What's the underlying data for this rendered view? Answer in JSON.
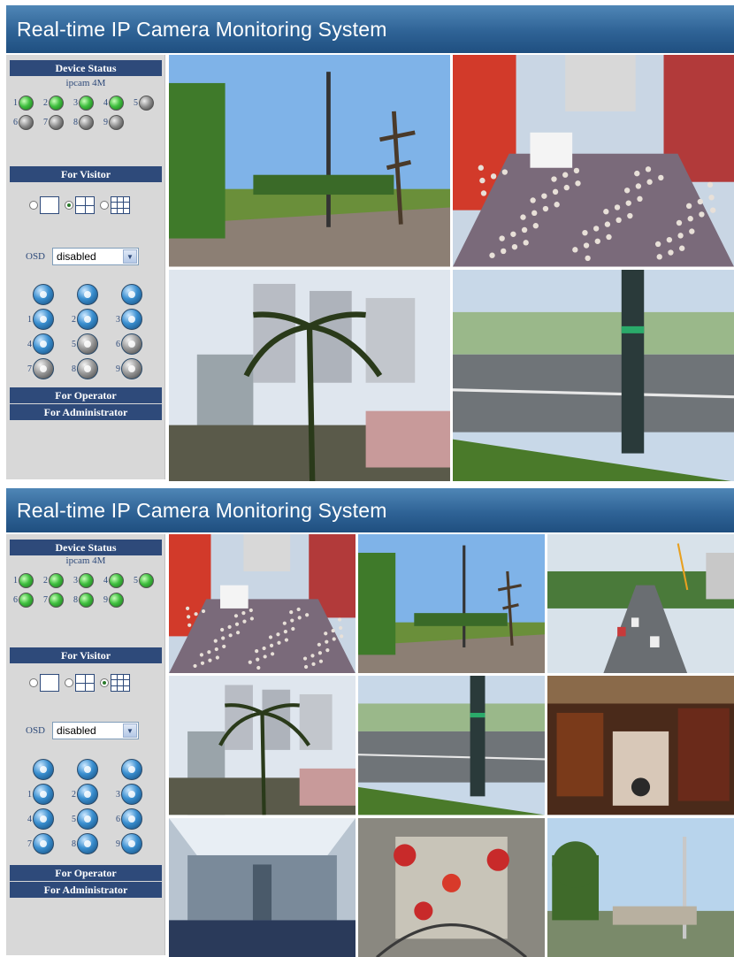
{
  "title": "Real-time IP Camera Monitoring System",
  "sidebar": {
    "device_status_label": "Device Status",
    "device_name": "ipcam 4M",
    "for_visitor_label": "For Visitor",
    "osd_label": "OSD",
    "osd_value": "disabled",
    "for_operator_label": "For Operator",
    "for_administrator_label": "For Administrator"
  },
  "device_numbers": [
    "1",
    "2",
    "3",
    "4",
    "5",
    "6",
    "7",
    "8",
    "9"
  ],
  "control_numbers": [
    "1",
    "2",
    "3",
    "4",
    "5",
    "6",
    "7",
    "8",
    "9"
  ],
  "status_colors": {
    "online": "#3fbf3f",
    "offline": "#8a8a8a",
    "header": "#2e4a7a"
  },
  "panel_a": {
    "devices": [
      "online",
      "online",
      "online",
      "online",
      "offline",
      "offline",
      "offline",
      "offline",
      "offline"
    ],
    "layout_selected": "4",
    "cameras": [
      {
        "scene": "park-street",
        "icon": "camera-view"
      },
      {
        "scene": "crowded-street",
        "icon": "camera-view"
      },
      {
        "scene": "palm-trees-buildings",
        "icon": "camera-view"
      },
      {
        "scene": "road-signpost",
        "icon": "camera-view"
      }
    ]
  },
  "panel_b": {
    "devices": [
      "online",
      "online",
      "online",
      "online",
      "online",
      "online",
      "online",
      "online",
      "online"
    ],
    "layout_selected": "9",
    "cameras": [
      {
        "scene": "crowded-street",
        "icon": "camera-view"
      },
      {
        "scene": "park-street",
        "icon": "camera-view"
      },
      {
        "scene": "highway-traffic",
        "icon": "camera-view"
      },
      {
        "scene": "palm-trees-buildings",
        "icon": "camera-view"
      },
      {
        "scene": "road-signpost",
        "icon": "camera-view"
      },
      {
        "scene": "shop-interior",
        "icon": "camera-view"
      },
      {
        "scene": "mall-atrium",
        "icon": "camera-view"
      },
      {
        "scene": "mall-lanterns",
        "icon": "camera-view"
      },
      {
        "scene": "plaza-lamp",
        "icon": "camera-view"
      }
    ]
  }
}
